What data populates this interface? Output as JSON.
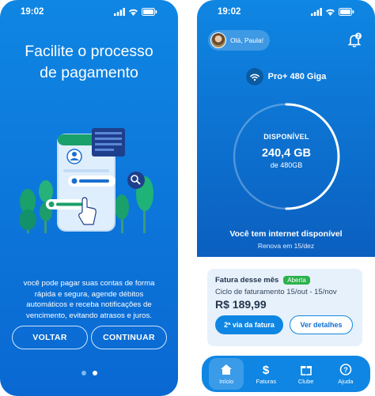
{
  "status": {
    "time": "19:02"
  },
  "onboarding": {
    "title_line1": "Facilite o processo",
    "title_line2": "de pagamento",
    "description": "você pode pagar suas contas de forma rápida e segura, agende débitos automáticos e receba notificações de vencimento, evitando atrasos e juros.",
    "back_label": "VOLTAR",
    "continue_label": "CONTINUAR",
    "page_total": 2,
    "page_current": 2
  },
  "home": {
    "greeting": "Olá, Paula!",
    "notification_count": "2",
    "plan_name": "Pro+ 480 Giga",
    "usage_label": "DISPONÍVEL",
    "usage_value": "240,4 GB",
    "usage_total": "de 480GB",
    "usage_fraction": 0.5,
    "internet_title": "Você tem internet disponível",
    "internet_renew": "Renova em 15/dez",
    "invoice": {
      "title": "Fatura desse mês",
      "status": "Aberta",
      "cycle": "Ciclo de faturamento 15/out - 15/nov",
      "amount": "R$ 189,99",
      "copy_label": "2ª via da fatura",
      "details_label": "Ver detalhes"
    },
    "tabs": [
      {
        "label": "Início",
        "icon": "home-icon",
        "active": true
      },
      {
        "label": "Faturas",
        "icon": "dollar-icon",
        "active": false
      },
      {
        "label": "Clube",
        "icon": "gift-icon",
        "active": false
      },
      {
        "label": "Ajuda",
        "icon": "help-icon",
        "active": false
      }
    ]
  },
  "colors": {
    "primary": "#0f86e3",
    "success": "#2bb24c",
    "card": "#e7f1fb"
  }
}
